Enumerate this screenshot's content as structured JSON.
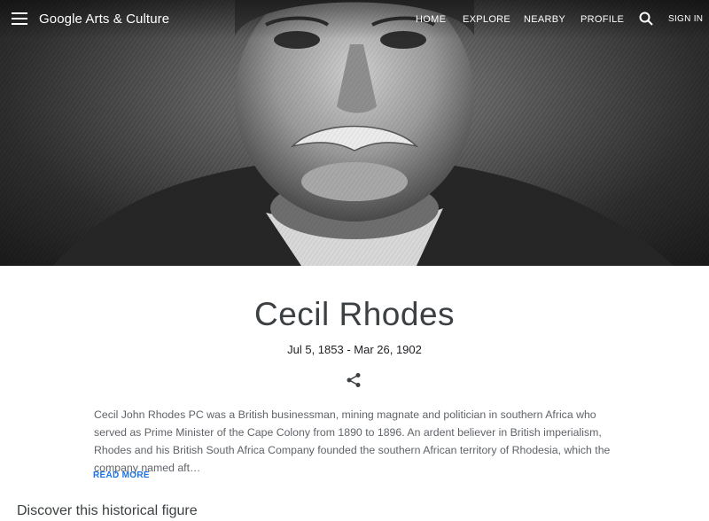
{
  "header": {
    "logo": "Google Arts & Culture",
    "nav": [
      "HOME",
      "EXPLORE",
      "NEARBY",
      "PROFILE"
    ],
    "signin": "SIGN IN",
    "icons": [
      "menu-icon",
      "search-icon"
    ]
  },
  "figure": {
    "name": "Cecil Rhodes",
    "dates": "Jul 5, 1853 - Mar 26, 1902",
    "description": "Cecil John Rhodes PC was a British businessman, mining magnate and politician in southern Africa who served as Prime Minister of the Cape Colony from 1890 to 1896. An ardent believer in British imperialism, Rhodes and his British South Africa Company founded the southern African territory of Rhodesia, which the company named aft…",
    "read_more": "READ MORE"
  },
  "sections": {
    "discover": "Discover this historical figure"
  },
  "colors": {
    "accent": "#1a73e8",
    "title": "#3c4043",
    "body_text": "#5f6368"
  }
}
